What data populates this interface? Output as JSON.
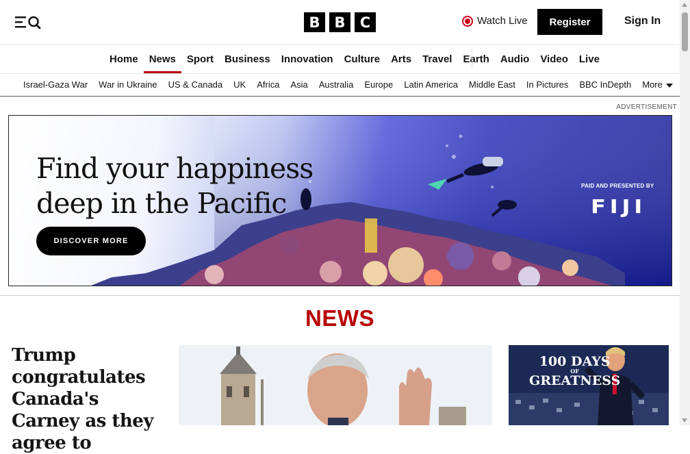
{
  "header": {
    "logo_letters": [
      "B",
      "B",
      "C"
    ],
    "watch_live": "Watch Live",
    "register": "Register",
    "sign_in": "Sign In"
  },
  "main_nav": {
    "items": [
      {
        "label": "Home"
      },
      {
        "label": "News",
        "active": true
      },
      {
        "label": "Sport"
      },
      {
        "label": "Business"
      },
      {
        "label": "Innovation"
      },
      {
        "label": "Culture"
      },
      {
        "label": "Arts"
      },
      {
        "label": "Travel"
      },
      {
        "label": "Earth"
      },
      {
        "label": "Audio"
      },
      {
        "label": "Video"
      },
      {
        "label": "Live"
      }
    ]
  },
  "sub_nav": {
    "items": [
      {
        "label": "Israel-Gaza War"
      },
      {
        "label": "War in Ukraine"
      },
      {
        "label": "US & Canada"
      },
      {
        "label": "UK"
      },
      {
        "label": "Africa"
      },
      {
        "label": "Asia"
      },
      {
        "label": "Australia"
      },
      {
        "label": "Europe"
      },
      {
        "label": "Latin America"
      },
      {
        "label": "Middle East"
      },
      {
        "label": "In Pictures"
      },
      {
        "label": "BBC InDepth"
      }
    ],
    "more": "More"
  },
  "ad": {
    "label": "ADVERTISEMENT",
    "headline_line1": "Find your happiness",
    "headline_line2": "deep in the Pacific",
    "cta": "DISCOVER MORE",
    "paid_label": "PAID AND PRESENTED BY",
    "brand": "FIJI"
  },
  "news": {
    "section_title": "NEWS",
    "lead_headline": "Trump congratulates Canada's Carney as they agree to",
    "side_banner_line1": "100 DAYS",
    "side_banner_line2": "OF",
    "side_banner_line3": "GREATNESS"
  },
  "colors": {
    "brand_red": "#b80000",
    "live_red": "#d20019",
    "black": "#000000"
  }
}
